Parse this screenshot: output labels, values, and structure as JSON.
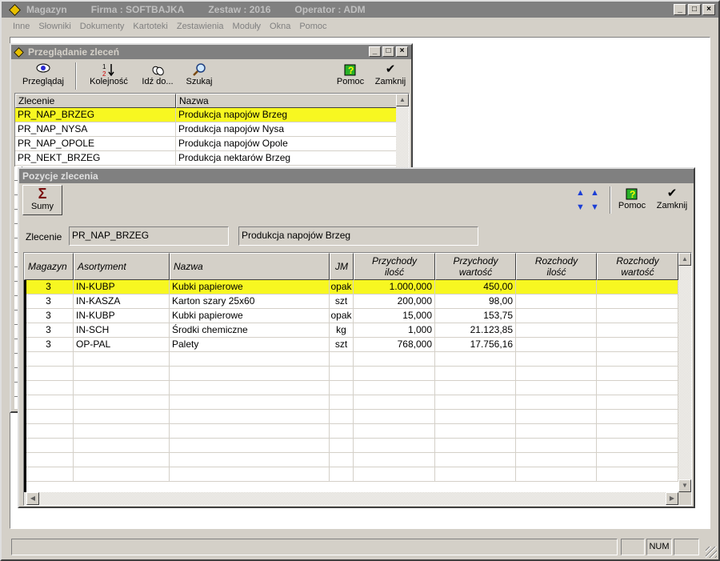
{
  "app": {
    "title_items": [
      "Magazyn",
      "Firma : SOFTBAJKA",
      "Zestaw : 2016",
      "Operator : ADM"
    ],
    "window_buttons": [
      "_",
      "□",
      "×"
    ]
  },
  "menu": [
    "Inne",
    "Słowniki",
    "Dokumenty",
    "Kartoteki",
    "Zestawienia",
    "Moduły",
    "Okna",
    "Pomoc"
  ],
  "browse_window": {
    "title": "Przeglądanie zleceń",
    "toolbar": {
      "przegladaj": "Przeglądaj",
      "kolejnosc": "Kolejność",
      "idz_do": "Idź do...",
      "szukaj": "Szukaj",
      "pomoc": "Pomoc",
      "zamknij": "Zamknij"
    },
    "columns": [
      "Zlecenie",
      "Nazwa"
    ],
    "rows": [
      {
        "zlecenie": "PR_NAP_BRZEG",
        "nazwa": "Produkcja napojów Brzeg"
      },
      {
        "zlecenie": "PR_NAP_NYSA",
        "nazwa": "Produkcja napojów Nysa"
      },
      {
        "zlecenie": "PR_NAP_OPOLE",
        "nazwa": "Produkcja napojów Opole"
      },
      {
        "zlecenie": "PR_NEKT_BRZEG",
        "nazwa": "Produkcja nektarów Brzeg"
      }
    ]
  },
  "positions_window": {
    "title": "Pozycje zlecenia",
    "toolbar": {
      "sumy": "Sumy",
      "pomoc": "Pomoc",
      "zamknij": "Zamknij"
    },
    "filter": {
      "label": "Zlecenie",
      "code": "PR_NAP_BRZEG",
      "name": "Produkcja napojów Brzeg"
    },
    "columns": {
      "magazyn": "Magazyn",
      "asortyment": "Asortyment",
      "nazwa": "Nazwa",
      "jm": "JM",
      "przychody_ilosc_1": "Przychody",
      "przychody_ilosc_2": "ilość",
      "przychody_wartosc_1": "Przychody",
      "przychody_wartosc_2": "wartość",
      "rozchody_ilosc_1": "Rozchody",
      "rozchody_ilosc_2": "ilość",
      "rozchody_wartosc_1": "Rozchody",
      "rozchody_wartosc_2": "wartość"
    },
    "rows": [
      {
        "magazyn": "3",
        "asortyment": "IN-KUBP",
        "nazwa": "Kubki papierowe",
        "jm": "opak",
        "p_ilosc": "1.000,000",
        "p_wartosc": "450,00",
        "r_ilosc": "",
        "r_wartosc": ""
      },
      {
        "magazyn": "3",
        "asortyment": "IN-KASZA",
        "nazwa": "Karton szary 25x60",
        "jm": "szt",
        "p_ilosc": "200,000",
        "p_wartosc": "98,00",
        "r_ilosc": "",
        "r_wartosc": ""
      },
      {
        "magazyn": "3",
        "asortyment": "IN-KUBP",
        "nazwa": "Kubki papierowe",
        "jm": "opak",
        "p_ilosc": "15,000",
        "p_wartosc": "153,75",
        "r_ilosc": "",
        "r_wartosc": ""
      },
      {
        "magazyn": "3",
        "asortyment": "IN-SCH",
        "nazwa": "Środki chemiczne",
        "jm": "kg",
        "p_ilosc": "1,000",
        "p_wartosc": "21.123,85",
        "r_ilosc": "",
        "r_wartosc": ""
      },
      {
        "magazyn": "3",
        "asortyment": "OP-PAL",
        "nazwa": "Palety",
        "jm": "szt",
        "p_ilosc": "768,000",
        "p_wartosc": "17.756,16",
        "r_ilosc": "",
        "r_wartosc": ""
      }
    ]
  },
  "status": {
    "num": "NUM"
  },
  "colors": {
    "selection": "#f7f721",
    "face": "#d4d0c8",
    "title_inactive": "#808080"
  }
}
